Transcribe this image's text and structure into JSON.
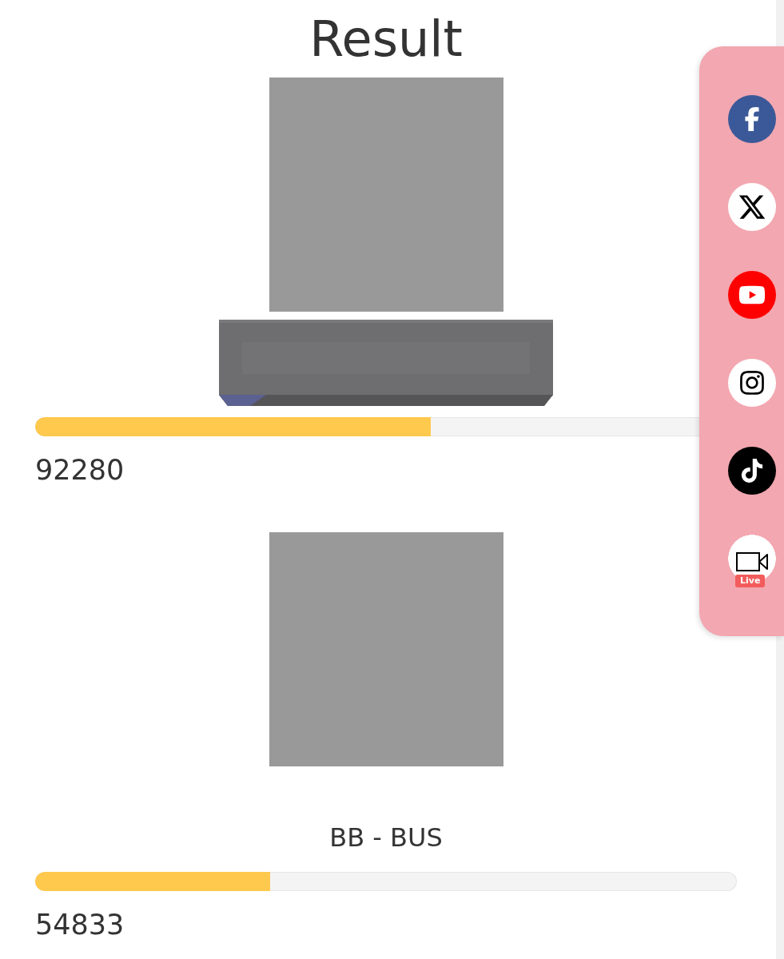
{
  "title": "Result",
  "results": [
    {
      "media": [
        {
          "kind": "placeholder"
        },
        {
          "kind": "picture"
        }
      ],
      "level": 0.564,
      "count": "92280"
    },
    {
      "media": [
        {
          "kind": "placeholder"
        }
      ],
      "name": "BB - BUS",
      "level": 0.335,
      "count": "54833"
    }
  ],
  "social": [
    {
      "kind": "facebook"
    },
    {
      "kind": "x"
    },
    {
      "kind": "youtube"
    },
    {
      "kind": "instagram"
    },
    {
      "kind": "tiktok"
    },
    {
      "kind": "live",
      "badge": "Live"
    }
  ]
}
